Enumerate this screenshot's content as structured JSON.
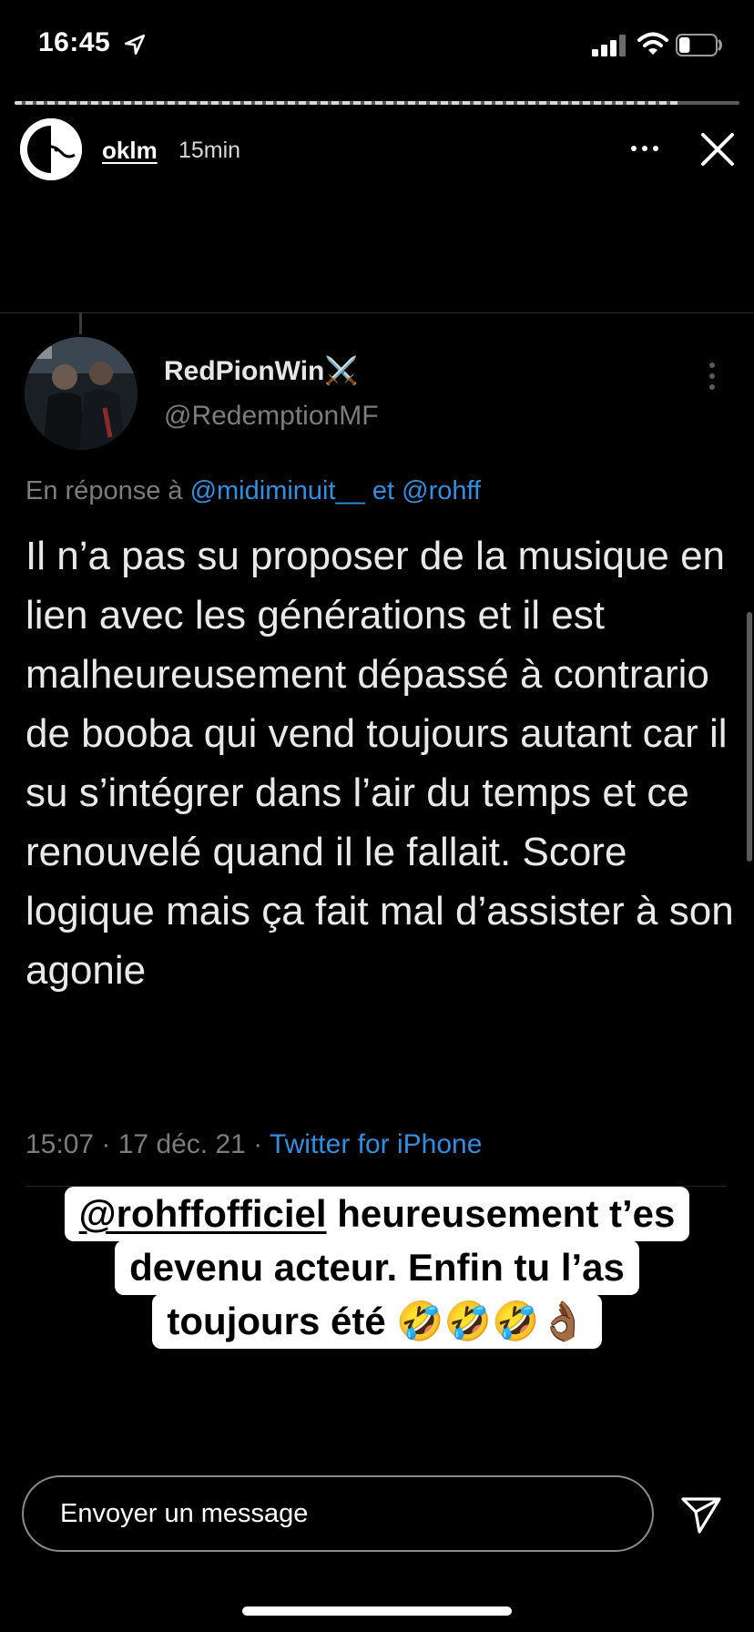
{
  "status_bar": {
    "time": "16:45",
    "battery_level": 0.3
  },
  "story": {
    "progress": 0.92,
    "username": "oklm",
    "time_ago": "15min"
  },
  "tweet": {
    "display_name": "RedPionWin⚔️",
    "handle": "@RedemptionMF",
    "reply_prefix": "En réponse à",
    "reply_mention_1": "@midiminuit__",
    "reply_connector": "et",
    "reply_mention_2": "@rohff",
    "text": "Il n’a pas su proposer de la musique en lien avec les générations et il est malheureusement dépassé à contrario de booba qui vend toujours autant car il su s’intégrer dans l’air du temps et ce renouvelé quand il le fallait. Score logique mais ça fait mal d’assister à son agonie",
    "timestamp": "15:07 · 17 déc. 21 ·",
    "source": "Twitter for iPhone"
  },
  "caption": {
    "mention": "@rohffofficiel",
    "line1_rest": " heureusement t’es",
    "line2": "devenu acteur. Enfin tu l’as",
    "line3_text": "toujours été ",
    "line3_emoji": "🤣🤣🤣👌🏾"
  },
  "message_bar": {
    "placeholder": "Envoyer un message"
  },
  "icons": {
    "location": "location-arrow-icon",
    "signal": "cellular-signal-icon",
    "wifi": "wifi-icon",
    "battery": "battery-icon",
    "more": "more-icon",
    "close": "close-icon",
    "send": "send-icon"
  }
}
